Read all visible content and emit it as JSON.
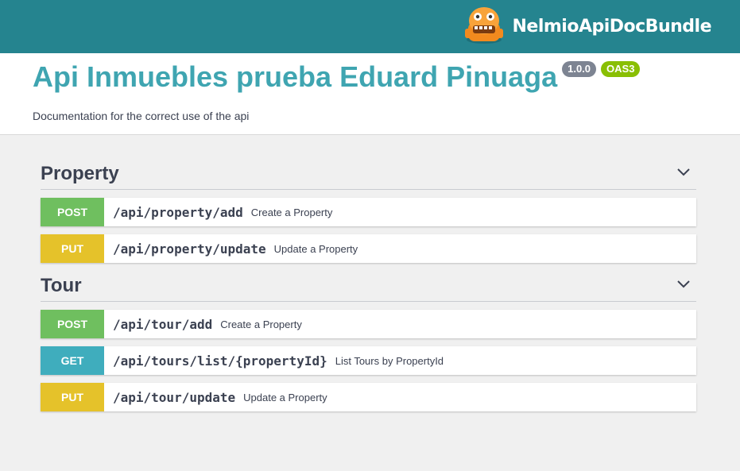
{
  "topbar": {
    "brand_name": "NelmioApiDocBundle",
    "logo_icon": "nelmio-mascot-icon",
    "colors": {
      "background": "#25848f"
    }
  },
  "info": {
    "title": "Api Inmuebles prueba Eduard Pinuaga",
    "version": "1.0.0",
    "spec": "OAS3",
    "description": "Documentation for the correct use of the api"
  },
  "sections": [
    {
      "name": "Property",
      "operations": [
        {
          "method": "POST",
          "path": "/api/property/add",
          "summary": "Create a Property"
        },
        {
          "method": "PUT",
          "path": "/api/property/update",
          "summary": "Update a Property"
        }
      ]
    },
    {
      "name": "Tour",
      "operations": [
        {
          "method": "POST",
          "path": "/api/tour/add",
          "summary": "Create a Property"
        },
        {
          "method": "GET",
          "path": "/api/tours/list/{propertyId}",
          "summary": "List Tours by PropertyId"
        },
        {
          "method": "PUT",
          "path": "/api/tour/update",
          "summary": "Update a Property"
        }
      ]
    }
  ],
  "method_colors": {
    "POST": "#6fbf5f",
    "PUT": "#e5c22a",
    "GET": "#3fadbd"
  }
}
